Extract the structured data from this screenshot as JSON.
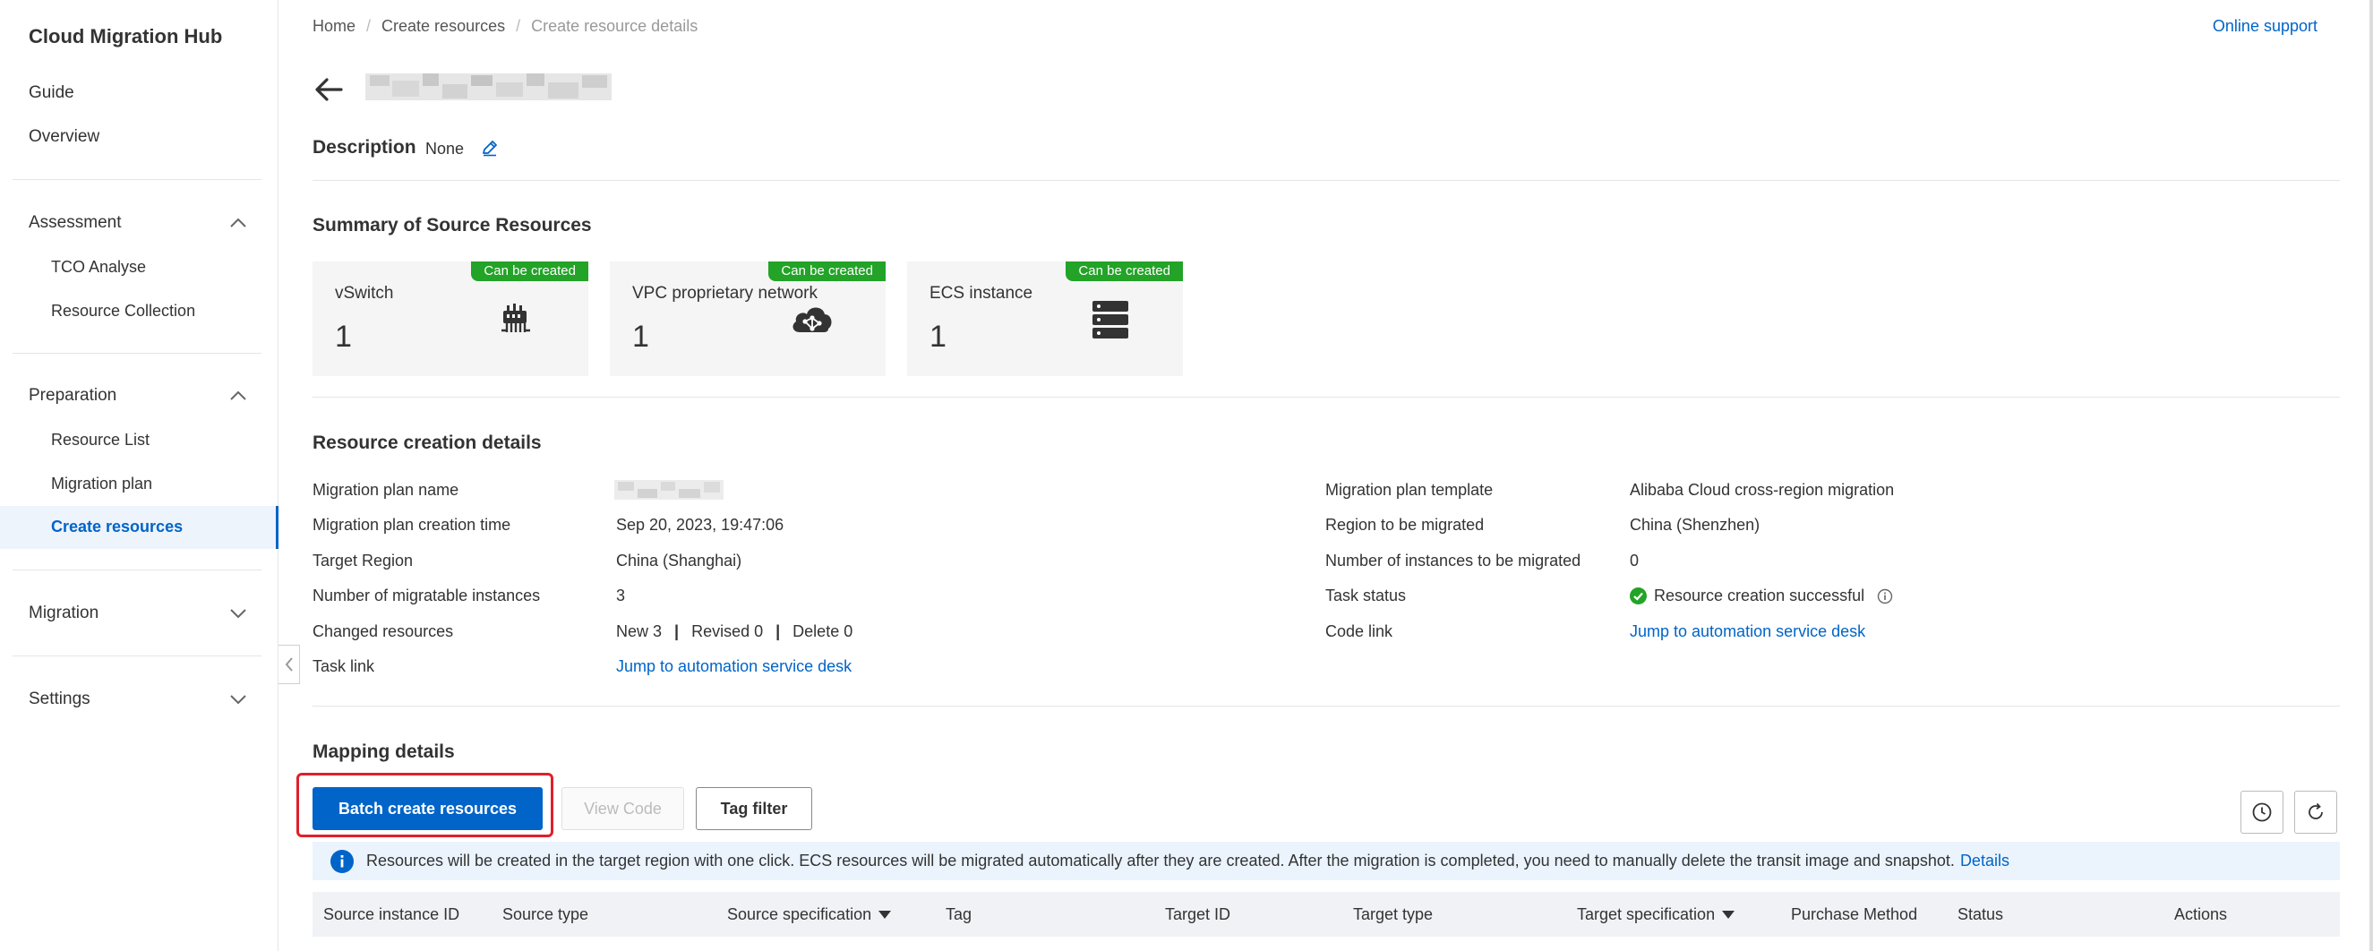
{
  "sidebar": {
    "app_title": "Cloud Migration Hub",
    "guide": "Guide",
    "overview": "Overview",
    "assessment": "Assessment",
    "tco_analyse": "TCO Analyse",
    "resource_collection": "Resource Collection",
    "preparation": "Preparation",
    "resource_list": "Resource List",
    "migration_plan": "Migration plan",
    "create_resources": "Create resources",
    "migration": "Migration",
    "settings": "Settings"
  },
  "breadcrumb": {
    "home": "Home",
    "create_resources": "Create resources",
    "current": "Create resource details",
    "separator": "/"
  },
  "header": {
    "online_support": "Online support"
  },
  "description": {
    "label": "Description",
    "value": "None"
  },
  "summary": {
    "title": "Summary of Source Resources",
    "cards": [
      {
        "label": "vSwitch",
        "value": "1",
        "badge": "Can be created",
        "icon": "vswitch-icon"
      },
      {
        "label": "VPC proprietary network",
        "value": "1",
        "badge": "Can be created",
        "icon": "cloud-network-icon"
      },
      {
        "label": "ECS instance",
        "value": "1",
        "badge": "Can be created",
        "icon": "server-icon"
      }
    ]
  },
  "details": {
    "title": "Resource creation details",
    "left": {
      "plan_name_label": "Migration plan name",
      "creation_time_label": "Migration plan creation time",
      "creation_time_value": "Sep 20, 2023, 19:47:06",
      "target_region_label": "Target Region",
      "target_region_value": "China (Shanghai)",
      "migratable_label": "Number of migratable instances",
      "migratable_value": "3",
      "changed_label": "Changed resources",
      "changed_new": "New 3",
      "changed_revised": "Revised 0",
      "changed_delete": "Delete 0",
      "task_link_label": "Task link",
      "task_link_value": "Jump to automation service desk"
    },
    "right": {
      "template_label": "Migration plan template",
      "template_value": "Alibaba Cloud cross-region migration",
      "region_migrated_label": "Region to be migrated",
      "region_migrated_value": "China (Shenzhen)",
      "instances_migrated_label": "Number of instances to be migrated",
      "instances_migrated_value": "0",
      "task_status_label": "Task status",
      "task_status_value": "Resource creation successful",
      "code_link_label": "Code link",
      "code_link_value": "Jump to automation service desk"
    }
  },
  "mapping": {
    "title": "Mapping details",
    "batch_create": "Batch create resources",
    "view_code": "View Code",
    "tag_filter": "Tag filter",
    "notice": "Resources will be created in the target region with one click. ECS resources will be migrated automatically after they are created. After the migration is completed, you need to manually delete the transit image and snapshot.",
    "notice_link": "Details",
    "columns": {
      "source_instance_id": "Source instance ID",
      "source_type": "Source type",
      "source_spec": "Source specification",
      "tag": "Tag",
      "target_id": "Target ID",
      "target_type": "Target type",
      "target_spec": "Target specification",
      "purchase_method": "Purchase Method",
      "status": "Status",
      "actions": "Actions"
    }
  },
  "colors": {
    "primary": "#0064c8",
    "success": "#23a327",
    "highlight": "#e0202a"
  }
}
